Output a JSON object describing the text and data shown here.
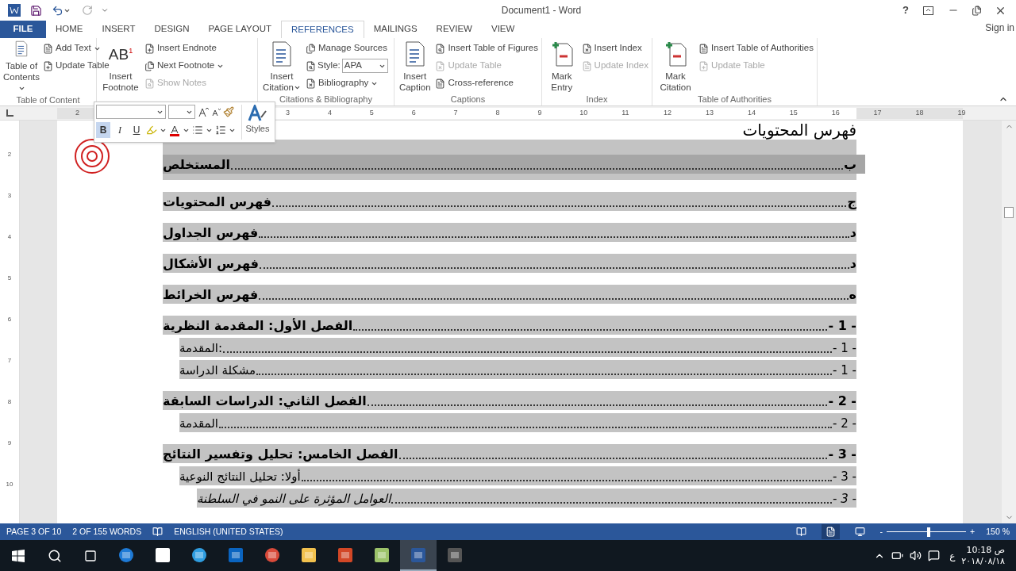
{
  "window": {
    "title": "Document1 - Word",
    "help": "?",
    "sign_in": "Sign in"
  },
  "tabs": [
    {
      "label": "FILE",
      "kind": "file",
      "selected": false
    },
    {
      "label": "HOME",
      "kind": "tab",
      "selected": false
    },
    {
      "label": "INSERT",
      "kind": "tab",
      "selected": false
    },
    {
      "label": "DESIGN",
      "kind": "tab",
      "selected": false
    },
    {
      "label": "PAGE LAYOUT",
      "kind": "tab",
      "selected": false
    },
    {
      "label": "REFERENCES",
      "kind": "tab",
      "selected": true
    },
    {
      "label": "MAILINGS",
      "kind": "tab",
      "selected": false
    },
    {
      "label": "REVIEW",
      "kind": "tab",
      "selected": false
    },
    {
      "label": "VIEW",
      "kind": "tab",
      "selected": false
    }
  ],
  "ribbon": [
    {
      "label": "Table of Content",
      "big": [
        {
          "label": "Table of Contents",
          "dropdown": true
        }
      ],
      "small": [
        {
          "label": "Add Text",
          "disabled": false,
          "dropdown": true
        },
        {
          "label": "Update Table",
          "disabled": false,
          "dropdown": false
        }
      ]
    },
    {
      "big": [
        {
          "label": "Insert Footnote",
          "icon_text": "AB",
          "icon_sup": "1",
          "dropdown": false
        }
      ],
      "small": [
        {
          "label": "Insert Endnote",
          "disabled": false,
          "dropdown": false
        },
        {
          "label": "Next Footnote",
          "disabled": false,
          "dropdown": true
        },
        {
          "label": "Show Notes",
          "disabled": true,
          "dropdown": false
        }
      ]
    },
    {
      "label": "Citations & Bibliography",
      "big": [
        {
          "label": "Insert Citation",
          "dropdown": true
        }
      ],
      "small": [
        {
          "label": "Manage Sources",
          "disabled": false,
          "dropdown": false
        },
        {
          "label": "Style:",
          "kind": "select",
          "value": "APA",
          "disabled": false,
          "dropdown": true
        },
        {
          "label": "Bibliography",
          "disabled": false,
          "dropdown": true
        }
      ]
    },
    {
      "label": "Captions",
      "big": [
        {
          "label": "Insert Caption",
          "dropdown": false
        }
      ],
      "small": [
        {
          "label": "Insert Table of Figures",
          "disabled": false,
          "dropdown": false
        },
        {
          "label": "Update Table",
          "disabled": true,
          "dropdown": false
        },
        {
          "label": "Cross-reference",
          "disabled": false,
          "dropdown": false
        }
      ]
    },
    {
      "label": "Index",
      "big": [
        {
          "label": "Mark Entry",
          "dropdown": false
        }
      ],
      "small": [
        {
          "label": "Insert Index",
          "disabled": false,
          "dropdown": false
        },
        {
          "label": "Update Index",
          "disabled": true,
          "dropdown": false
        }
      ]
    },
    {
      "label": "Table of Authorities",
      "big": [
        {
          "label": "Mark Citation",
          "dropdown": false
        }
      ],
      "small": [
        {
          "label": "Insert Table of Authorities",
          "disabled": false,
          "dropdown": false
        },
        {
          "label": "Update Table",
          "disabled": true,
          "dropdown": false
        }
      ]
    }
  ],
  "mini_toolbar": {
    "buttons": [
      {
        "label": "B",
        "kind": "bold",
        "selected": true
      },
      {
        "label": "I",
        "kind": "italic",
        "selected": false
      },
      {
        "label": "U",
        "kind": "underline",
        "selected": false
      }
    ],
    "styles": "Styles"
  },
  "ruler": {
    "labels": [
      "2",
      "3",
      "4",
      "5",
      "6",
      "7",
      "8",
      "9",
      "10",
      "11",
      "12",
      "13",
      "14",
      "15",
      "16",
      "17",
      "18",
      "19"
    ],
    "vertical": [
      "2",
      "3",
      "4",
      "5",
      "6",
      "7",
      "8",
      "9",
      "10"
    ]
  },
  "document": {
    "heading": "فهرس المحتويات",
    "toc": [
      {
        "text": "المستخلص",
        "page": "ب",
        "kind": "level1",
        "selected": true
      },
      {
        "text": "فهرس المحتويات",
        "page": "ج",
        "kind": "level1",
        "selected": false
      },
      {
        "text": "فهرس الجداول",
        "page": "د",
        "kind": "level1",
        "selected": false
      },
      {
        "text": "فهرس الأشكال",
        "page": "د",
        "kind": "level1",
        "selected": false
      },
      {
        "text": "فهرس الخرائط",
        "page": "ه",
        "kind": "level1",
        "selected": false
      },
      {
        "text": "الفصل الأول: المقدمة النظرية",
        "page": "- 1 -",
        "kind": "level1",
        "selected": false
      },
      {
        "text": "المقدمة:",
        "page": "- 1 -",
        "kind": "level2",
        "selected": false
      },
      {
        "text": "مشكلة الدراسة",
        "page": "- 1 -",
        "kind": "level2",
        "selected": false
      },
      {
        "text": "الفصل الثاني: الدراسات السابقة",
        "page": "- 2 -",
        "kind": "level1",
        "selected": false
      },
      {
        "text": "المقدمة",
        "page": "- 2 -",
        "kind": "level2",
        "selected": false
      },
      {
        "text": "الفصل الخامس: تحليل وتفسير النتائج",
        "page": "- 3 -",
        "kind": "level1",
        "selected": false
      },
      {
        "text": "أولا: تحليل النتائج النوعية",
        "page": "- 3 -",
        "kind": "level2",
        "selected": false
      },
      {
        "text": "العوامل المؤثرة على النمو في السلطنة",
        "page": "- 3 -",
        "kind": "level3",
        "selected": false
      }
    ]
  },
  "status_bar": {
    "page": "PAGE 3 OF 10",
    "words": "2 OF 155 WORDS",
    "language": "ENGLISH (UNITED STATES)",
    "views": [
      {
        "kind": "read",
        "selected": false
      },
      {
        "kind": "print",
        "selected": true
      },
      {
        "kind": "web",
        "selected": false
      }
    ],
    "minus": "-",
    "plus": "+",
    "zoom": {
      "level": 0.53
    },
    "zoom_text": "150 %"
  },
  "taskbar": {
    "apps": [
      {
        "kind": "edge",
        "active": false
      },
      {
        "kind": "store",
        "active": false
      },
      {
        "kind": "ie",
        "active": false
      },
      {
        "kind": "outlook",
        "active": false
      },
      {
        "kind": "chrome",
        "active": false
      },
      {
        "kind": "explorer",
        "active": false
      },
      {
        "kind": "powerpoint",
        "active": false
      },
      {
        "kind": "green",
        "active": false
      },
      {
        "kind": "word",
        "active": true
      },
      {
        "kind": "tool",
        "active": false
      }
    ],
    "input_language": "ع",
    "time": "10:18 ص",
    "date": "٢٠١٨/٠٨/١٨"
  }
}
